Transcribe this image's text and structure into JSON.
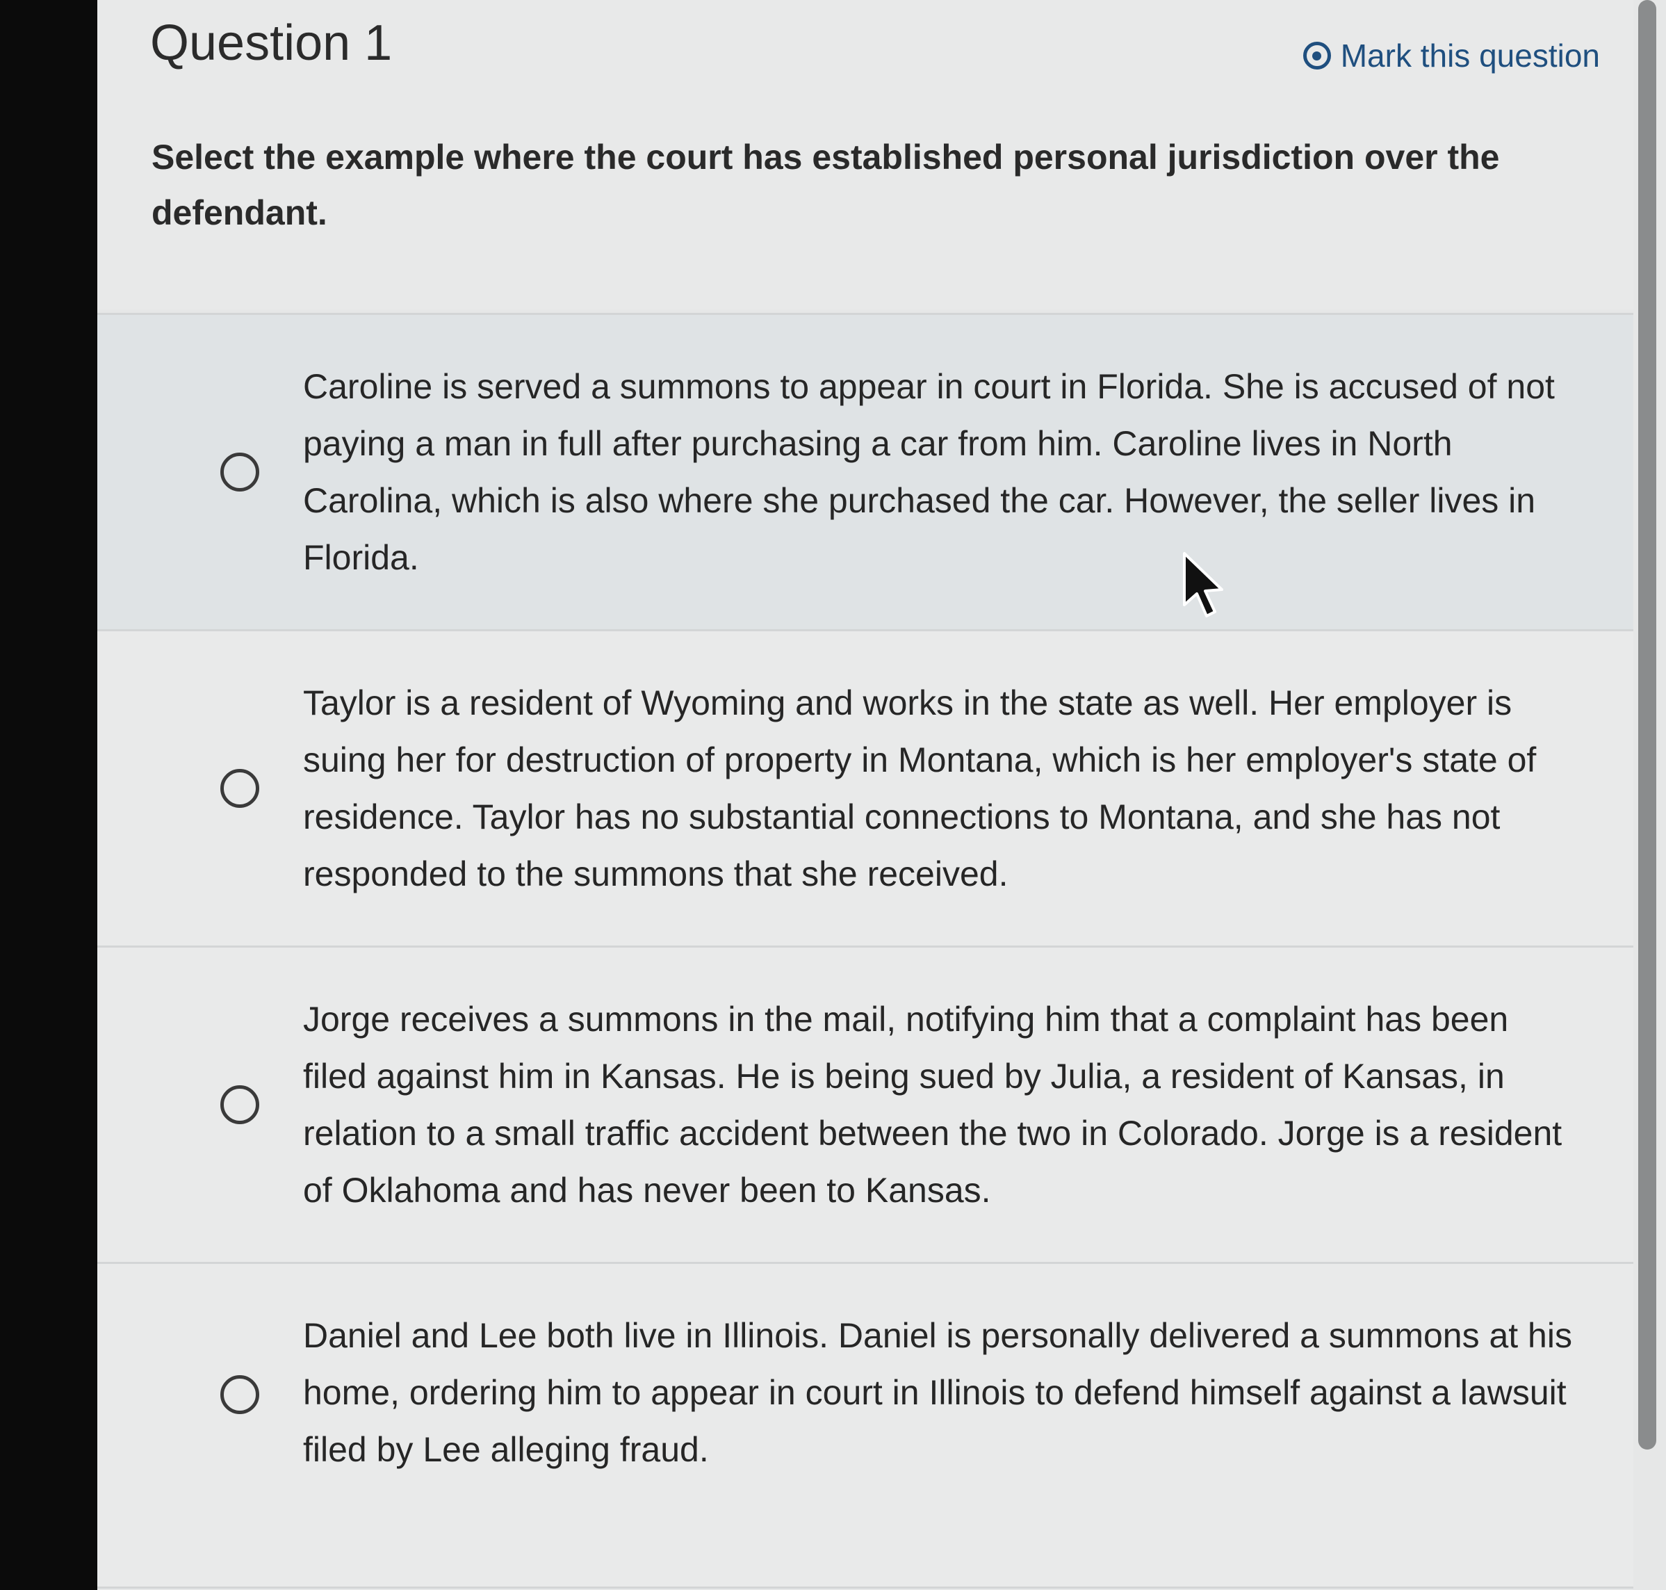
{
  "question": {
    "title": "Question 1",
    "mark_label": "Mark this question",
    "prompt": "Select the example where the court has established personal jurisdiction over the defendant."
  },
  "options": [
    {
      "text": "Caroline is served a summons to appear in court in Florida. She is accused of not paying a man in full after purchasing a car from him. Caroline lives in North Carolina, which is also where she purchased the car. However, the seller lives in Florida."
    },
    {
      "text": "Taylor is a resident of Wyoming and works in the state as well. Her employer is suing her for destruction of property in Montana, which is her employer's state of residence. Taylor has no substantial connections to Montana, and she has not responded to the summons that she received."
    },
    {
      "text": "Jorge receives a summons in the mail, notifying him that a complaint has been filed against him in Kansas. He is being sued by Julia, a resident of Kansas, in relation to a small traffic accident between the two in Colorado. Jorge is a resident of Oklahoma and has never been to Kansas."
    },
    {
      "text": "Daniel and Lee both live in Illinois. Daniel is personally delivered a summons at his home, ordering him to appear in court in Illinois to defend himself against a lawsuit filed by Lee alleging fraud."
    }
  ],
  "icons": {
    "mark": "radio-dot-icon",
    "option": "radio-empty-icon",
    "pointer": "mouse-cursor-icon"
  },
  "colors": {
    "accent": "#1f4f7f",
    "text": "#262626",
    "background": "#e6e7e7",
    "selected_row": "#dfe3e5"
  }
}
